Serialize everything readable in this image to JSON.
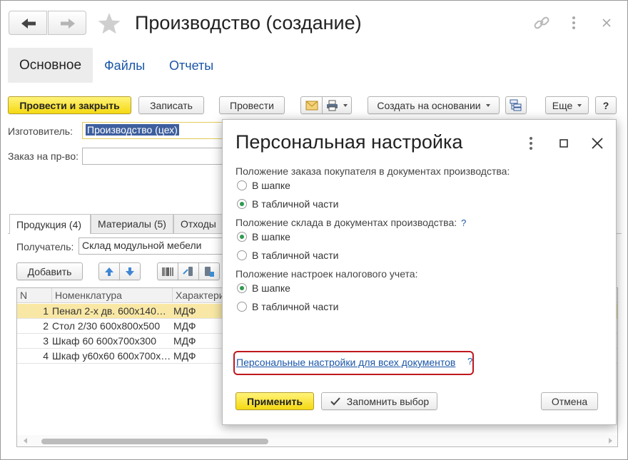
{
  "window": {
    "title": "Производство (создание)"
  },
  "tabs": [
    {
      "label": "Основное"
    },
    {
      "label": "Файлы"
    },
    {
      "label": "Отчеты"
    }
  ],
  "toolbar": {
    "post_close": "Провести и закрыть",
    "save": "Записать",
    "post": "Провести",
    "create_based": "Создать на основании",
    "more": "Еще",
    "help": "?"
  },
  "form": {
    "manufacturer_label": "Изготовитель:",
    "manufacturer_value": "Производство (цех)",
    "order_label": "Заказ на пр-во:",
    "order_value": ""
  },
  "subtabs": [
    {
      "label": "Продукция (4)"
    },
    {
      "label": "Материалы (5)"
    },
    {
      "label": "Отходы"
    }
  ],
  "recipient": {
    "label": "Получатель:",
    "value": "Склад модульной мебели"
  },
  "table_toolbar": {
    "add": "Добавить"
  },
  "table": {
    "columns": [
      "N",
      "Номенклатура",
      "Характери"
    ],
    "rows": [
      {
        "n": "1",
        "name": "Пенал 2-х дв. 600х140…",
        "char": "МДФ",
        "selected": true
      },
      {
        "n": "2",
        "name": "Стол 2/30 600x800x500",
        "char": "МДФ",
        "selected": false
      },
      {
        "n": "3",
        "name": "Шкаф 60 600x700x300",
        "char": "МДФ",
        "selected": false
      },
      {
        "n": "4",
        "name": "Шкаф у60х60 600x700x…",
        "char": "МДФ",
        "selected": false
      }
    ]
  },
  "dialog": {
    "title": "Персональная настройка",
    "groups": [
      {
        "label": "Положение заказа покупателя в документах производства:",
        "has_help": false,
        "options": [
          {
            "label": "В шапке",
            "checked": false
          },
          {
            "label": "В табличной части",
            "checked": true
          }
        ]
      },
      {
        "label": "Положение склада в документах производства:",
        "has_help": true,
        "options": [
          {
            "label": "В шапке",
            "checked": true
          },
          {
            "label": "В табличной части",
            "checked": false
          }
        ]
      },
      {
        "label": "Положение настроек налогового учета:",
        "has_help": false,
        "options": [
          {
            "label": "В шапке",
            "checked": true
          },
          {
            "label": "В табличной части",
            "checked": false
          }
        ]
      }
    ],
    "help_mark": "?",
    "link": "Персональные настройки для всех документов",
    "apply": "Применить",
    "remember": "Запомнить выбор",
    "cancel": "Отмена"
  },
  "colors": {
    "accent_yellow": "#f5d912",
    "link_blue": "#1a56a8",
    "highlight_red": "#c0181e",
    "radio_green": "#2e9a4e",
    "selected_row": "#f9e8a5"
  }
}
